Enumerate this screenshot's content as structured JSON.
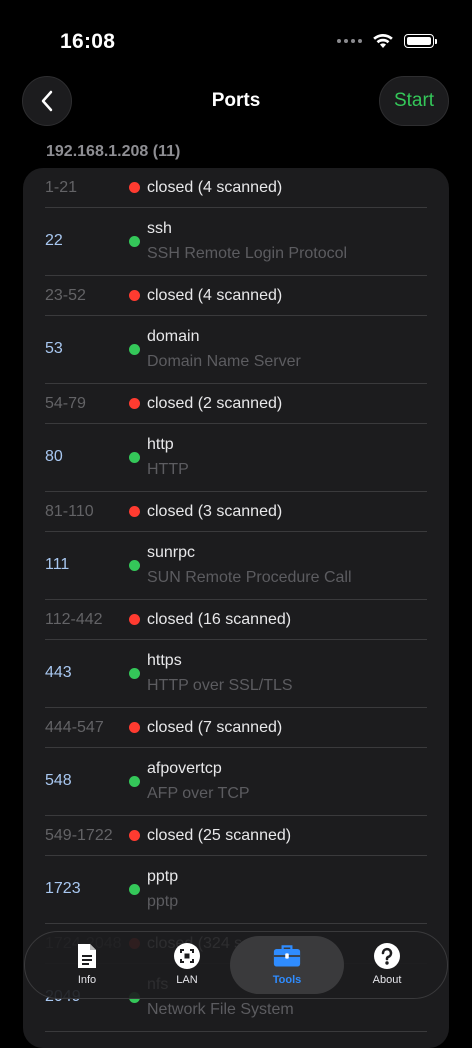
{
  "status_bar": {
    "time": "16:08"
  },
  "nav": {
    "title": "Ports",
    "start_label": "Start"
  },
  "section": {
    "header": "192.168.1.208 (11)"
  },
  "rows": [
    {
      "state": "closed",
      "port": "1-21",
      "name": "closed (4 scanned)",
      "desc": ""
    },
    {
      "state": "open",
      "port": "22",
      "name": "ssh",
      "desc": "SSH Remote Login Protocol"
    },
    {
      "state": "closed",
      "port": "23-52",
      "name": "closed (4 scanned)",
      "desc": ""
    },
    {
      "state": "open",
      "port": "53",
      "name": "domain",
      "desc": "Domain Name Server"
    },
    {
      "state": "closed",
      "port": "54-79",
      "name": "closed (2 scanned)",
      "desc": ""
    },
    {
      "state": "open",
      "port": "80",
      "name": "http",
      "desc": "HTTP"
    },
    {
      "state": "closed",
      "port": "81-110",
      "name": "closed (3 scanned)",
      "desc": ""
    },
    {
      "state": "open",
      "port": "111",
      "name": "sunrpc",
      "desc": "SUN Remote Procedure Call"
    },
    {
      "state": "closed",
      "port": "112-442",
      "name": "closed (16 scanned)",
      "desc": ""
    },
    {
      "state": "open",
      "port": "443",
      "name": "https",
      "desc": "HTTP over SSL/TLS"
    },
    {
      "state": "closed",
      "port": "444-547",
      "name": "closed (7 scanned)",
      "desc": ""
    },
    {
      "state": "open",
      "port": "548",
      "name": "afpovertcp",
      "desc": "AFP over TCP"
    },
    {
      "state": "closed",
      "port": "549-1722",
      "name": "closed (25 scanned)",
      "desc": ""
    },
    {
      "state": "open",
      "port": "1723",
      "name": "pptp",
      "desc": "pptp"
    },
    {
      "state": "closed",
      "port": "1724-2048",
      "name": "closed (324 scanned)",
      "desc": ""
    },
    {
      "state": "open",
      "port": "2049",
      "name": "nfs",
      "desc": "Network File System"
    }
  ],
  "tabs": [
    {
      "label": "Info",
      "icon": "document-icon",
      "active": false
    },
    {
      "label": "LAN",
      "icon": "lan-scan-icon",
      "active": false
    },
    {
      "label": "Tools",
      "icon": "toolbox-icon",
      "active": true
    },
    {
      "label": "About",
      "icon": "help-icon",
      "active": false
    }
  ],
  "colors": {
    "accent_green": "#34c759",
    "closed_red": "#ff3b30",
    "tab_active_blue": "#2f8cff"
  }
}
